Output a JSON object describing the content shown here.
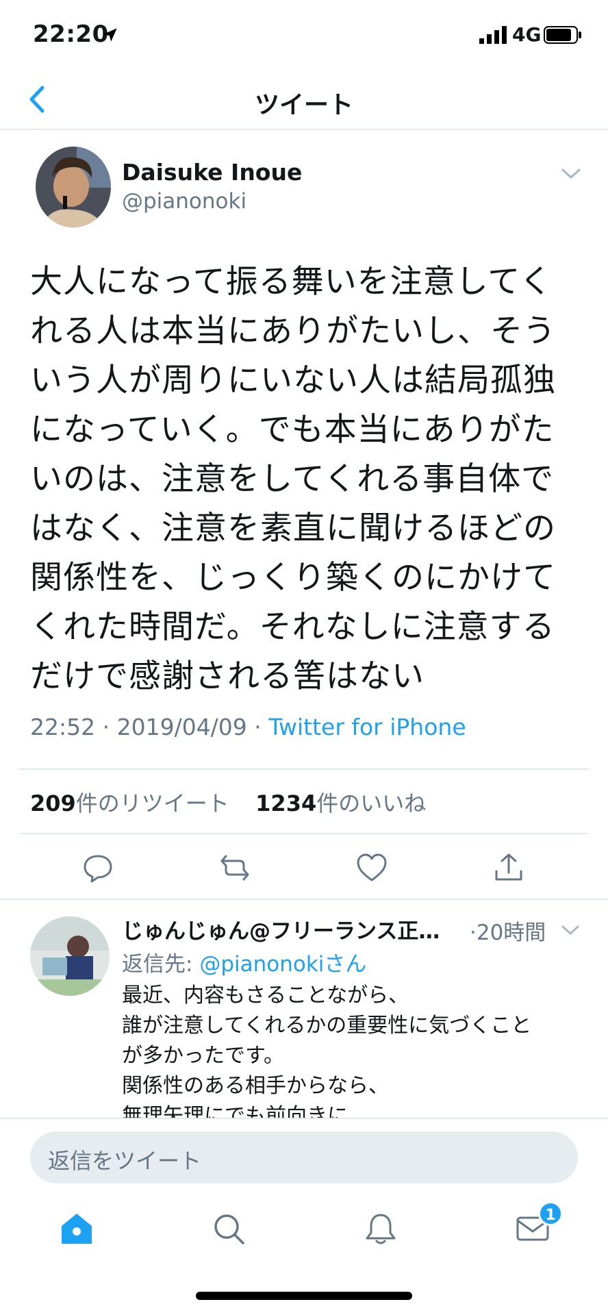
{
  "status_bar": {
    "time": "22:20",
    "network": "4G"
  },
  "nav": {
    "title": "ツイート"
  },
  "tweet": {
    "author_name": "Daisuke Inoue",
    "author_handle": "@pianonoki",
    "text": "大人になって振る舞いを注意してく\nれる人は本当にありがたいし、そう\nいう人が周りにいない人は結局孤独\nになっていく。でも本当にありがた\nいのは、注意をしてくれる事自体で\nはなく、注意を素直に聞けるほどの\n関係性を、じっくり築くのにかけて\nくれた時間だ。それなしに注意する\nだけで感謝される筈はない",
    "time": "22:52",
    "date": "2019/04/09",
    "source": "Twitter for iPhone",
    "retweet_count": "209",
    "retweet_label": "件のリツイート",
    "like_count": "1234",
    "like_label": "件のいいね"
  },
  "reply": {
    "name": "じゅんじゅん@フリーランス正…",
    "time": "·20時間",
    "replying_to_label": "返信先: ",
    "replying_to_handle": "@pianonokiさん",
    "text": "最近、内容もさることながら、\n誰が注意してくれるかの重要性に気づくこと\nが多かったです。\n関係性のある相手からなら、\n無理矢理にでも前向きに"
  },
  "compose": {
    "placeholder": "返信をツイート"
  },
  "tabbar": {
    "messages_badge": "1"
  },
  "colors": {
    "accent": "#1da1f2",
    "secondary_text": "#657786",
    "divider": "#e1e8ed"
  }
}
